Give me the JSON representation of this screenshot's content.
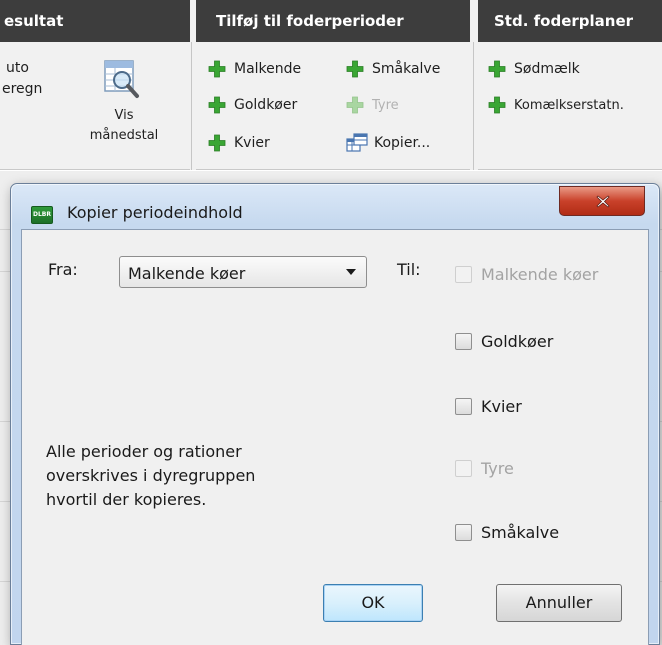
{
  "ribbon": {
    "groups": [
      {
        "title": "esultat",
        "items": [
          "uto",
          "eregn"
        ],
        "vis_label_line1": "Vis",
        "vis_label_line2": "månedstal"
      },
      {
        "title": "Tilføj til foderperioder",
        "items": [
          {
            "label": "Malkende",
            "icon": "plus-icon",
            "enabled": true
          },
          {
            "label": "Småkalve",
            "icon": "plus-icon",
            "enabled": true
          },
          {
            "label": "Goldkøer",
            "icon": "plus-icon",
            "enabled": true
          },
          {
            "label": "Tyre",
            "icon": "plus-icon",
            "enabled": false
          },
          {
            "label": "Kvier",
            "icon": "plus-icon",
            "enabled": true
          },
          {
            "label": "Kopier...",
            "icon": "copy-table-icon",
            "enabled": true
          }
        ]
      },
      {
        "title": "Std. foderplaner",
        "items": [
          {
            "label": "Sødmælk",
            "icon": "plus-icon",
            "enabled": true
          },
          {
            "label": "Komælkserstatn.",
            "icon": "plus-icon",
            "enabled": true
          }
        ]
      }
    ],
    "colors": {
      "header_bg": "#3d3d3d",
      "plus_green": "#3aa634",
      "plus_disabled": "#a9d6a1"
    }
  },
  "dialog": {
    "title": "Kopier periodeindhold",
    "app_icon_text": "DLBR",
    "from_label": "Fra:",
    "from_value": "Malkende køer",
    "to_label": "Til:",
    "targets": [
      {
        "label": "Malkende køer",
        "checked": false,
        "enabled": false
      },
      {
        "label": "Goldkøer",
        "checked": false,
        "enabled": true
      },
      {
        "label": "Kvier",
        "checked": false,
        "enabled": true
      },
      {
        "label": "Tyre",
        "checked": false,
        "enabled": false
      },
      {
        "label": "Småkalve",
        "checked": false,
        "enabled": true
      }
    ],
    "message_lines": [
      "Alle perioder og rationer",
      "overskrives i dyregruppen",
      "hvortil der kopieres."
    ],
    "ok_label": "OK",
    "cancel_label": "Annuller"
  }
}
